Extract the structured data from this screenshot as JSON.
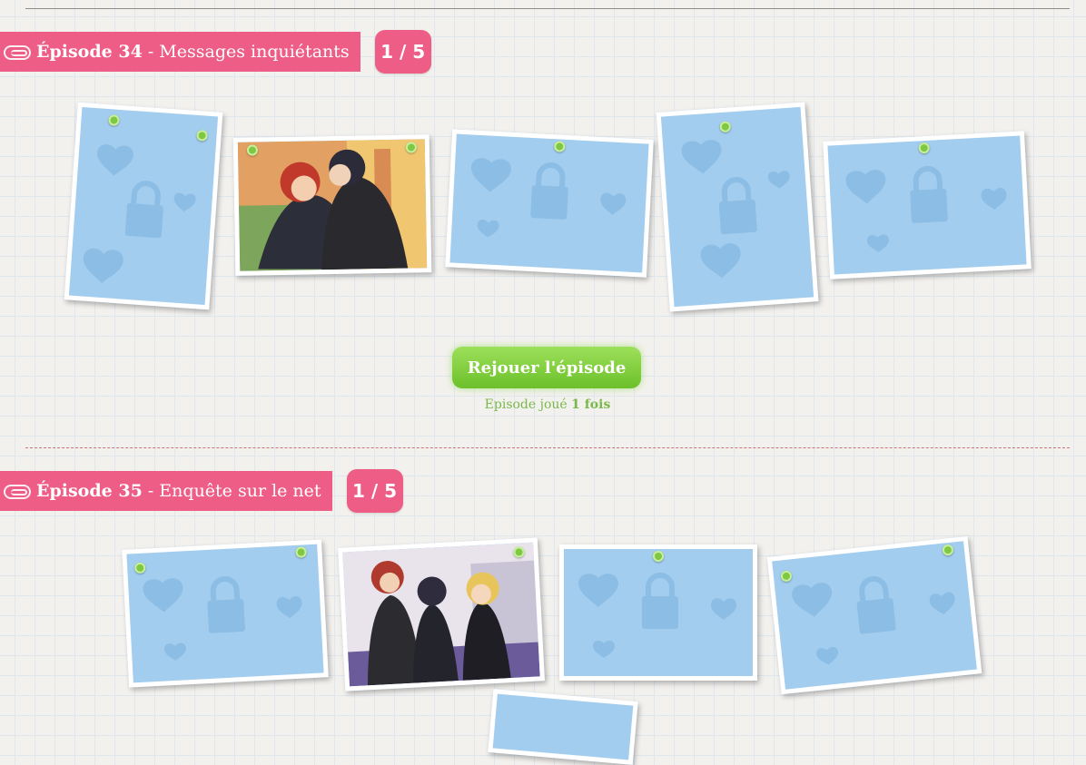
{
  "episodes": [
    {
      "label": "Épisode 34",
      "separator": " - ",
      "name": "Messages inquiétants",
      "counter": "1 / 5",
      "replay_label": "Rejouer l'épisode",
      "played_prefix": "Episode joué ",
      "played_count": "1 fois",
      "cards": [
        "locked-portrait",
        "scene-photo",
        "locked-landscape",
        "locked-portrait",
        "locked-landscape"
      ]
    },
    {
      "label": "Épisode 35",
      "separator": " - ",
      "name": "Enquête sur le net",
      "counter": "1 / 5",
      "cards": [
        "locked-landscape",
        "scene-photo",
        "locked-landscape",
        "locked-landscape",
        "locked-partial"
      ]
    }
  ],
  "icons": {
    "clip": "paperclip-icon",
    "lock": "lock-icon",
    "heart": "heart-icon",
    "pin": "pushpin-icon"
  },
  "colors": {
    "accent": "#ee5d86",
    "card_locked": "#a3cdee",
    "button_green": "#7bc935",
    "played_text": "#7ab84a"
  }
}
